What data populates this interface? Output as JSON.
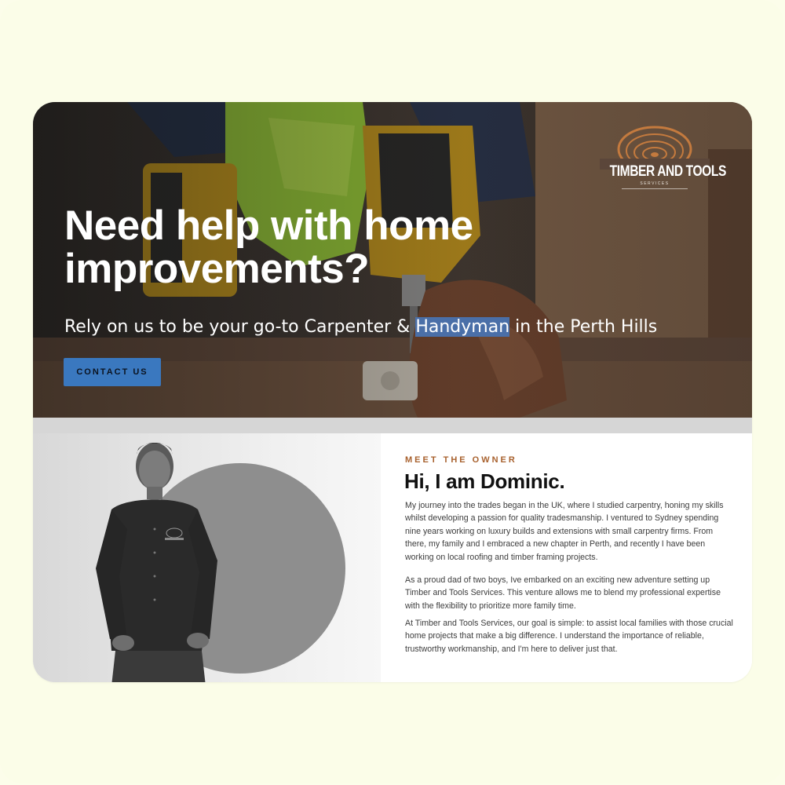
{
  "hero": {
    "logo_text": "TIMBER AND TOOLS",
    "logo_subtext": "SERVICES",
    "title_line1": "Need help with home",
    "title_line2": "improvements?",
    "subtitle_before": "Rely on us to be your go-to Carpenter & ",
    "subtitle_highlight": "Handyman",
    "subtitle_after": " in the Perth Hills",
    "cta_label": "CONTACT US"
  },
  "about": {
    "eyebrow": "MEET THE OWNER",
    "heading": "Hi, I am Dominic.",
    "paragraphs": [
      "My journey into the trades began in the UK, where I studied carpentry, honing my skills whilst developing a passion for quality tradesmanship. I ventured to Sydney spending nine years working on luxury builds and extensions with small carpentry firms. From there, my family and I embraced a new chapter in Perth, and recently I have been working on local roofing and timber framing projects.",
      "As a proud dad of two boys, Ive embarked on an exciting new adventure setting up Timber and Tools Services. This venture allows me to blend my professional expertise with the flexibility to prioritize more family time.",
      "At Timber and Tools Services, our goal is simple: to assist local families with those crucial home projects that make a big difference. I understand the importance of reliable, trustworthy workmanship, and I'm here to deliver just that."
    ]
  },
  "colors": {
    "page_bg": "#fcfdea",
    "cta_bg": "#3a78bf",
    "eyebrow": "#a8612e",
    "logo_accent": "#c47a3e",
    "highlight": "#4a6fa8"
  },
  "icons": {
    "logo": "tree-ring-hammer-logo"
  }
}
